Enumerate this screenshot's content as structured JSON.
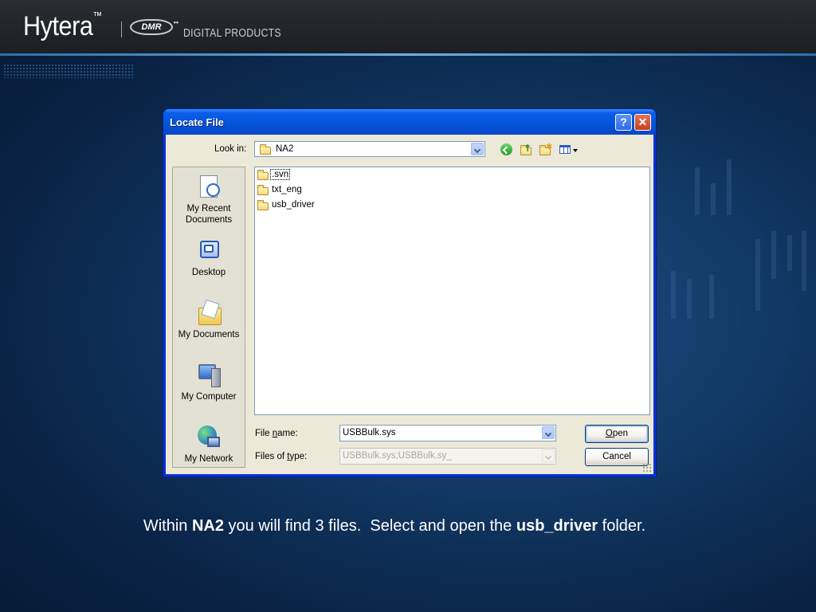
{
  "header": {
    "brand": "Hytera",
    "brand_mark": "™",
    "logo_text": "DMR",
    "logo_dots": "••",
    "tagline": "DIGITAL PRODUCTS"
  },
  "dialog": {
    "title": "Locate File",
    "help_glyph": "?",
    "close_glyph": "✕",
    "look_in_label": "Look in:",
    "look_in_value": "NA2",
    "toolbar_icons": [
      "back-icon",
      "up-folder-icon",
      "new-folder-icon",
      "views-menu-icon"
    ],
    "places": [
      {
        "label": "My Recent Documents",
        "icon": "recent-documents-icon"
      },
      {
        "label": "Desktop",
        "icon": "desktop-icon"
      },
      {
        "label": "My Documents",
        "icon": "my-documents-icon"
      },
      {
        "label": "My Computer",
        "icon": "my-computer-icon"
      },
      {
        "label": "My Network",
        "icon": "my-network-icon"
      }
    ],
    "files": [
      ".svn",
      "txt_eng",
      "usb_driver"
    ],
    "file_name_label": "File name:",
    "file_name_value": "USBBulk.sys",
    "file_type_label": "Files of type:",
    "file_type_value": "USBBulk.sys;USBBulk.sy_",
    "open_label": "Open",
    "cancel_label": "Cancel"
  },
  "caption": {
    "part1": "Within ",
    "bold1": "NA2",
    "part2": " you will find 3 files.  Select and open the ",
    "bold2": "usb_driver",
    "part3": " folder."
  },
  "colors": {
    "titlebar": "#0453d9",
    "dialog_face": "#ece9d8",
    "header_bg": "#1b1e22",
    "slide_bg": "#123a66"
  }
}
